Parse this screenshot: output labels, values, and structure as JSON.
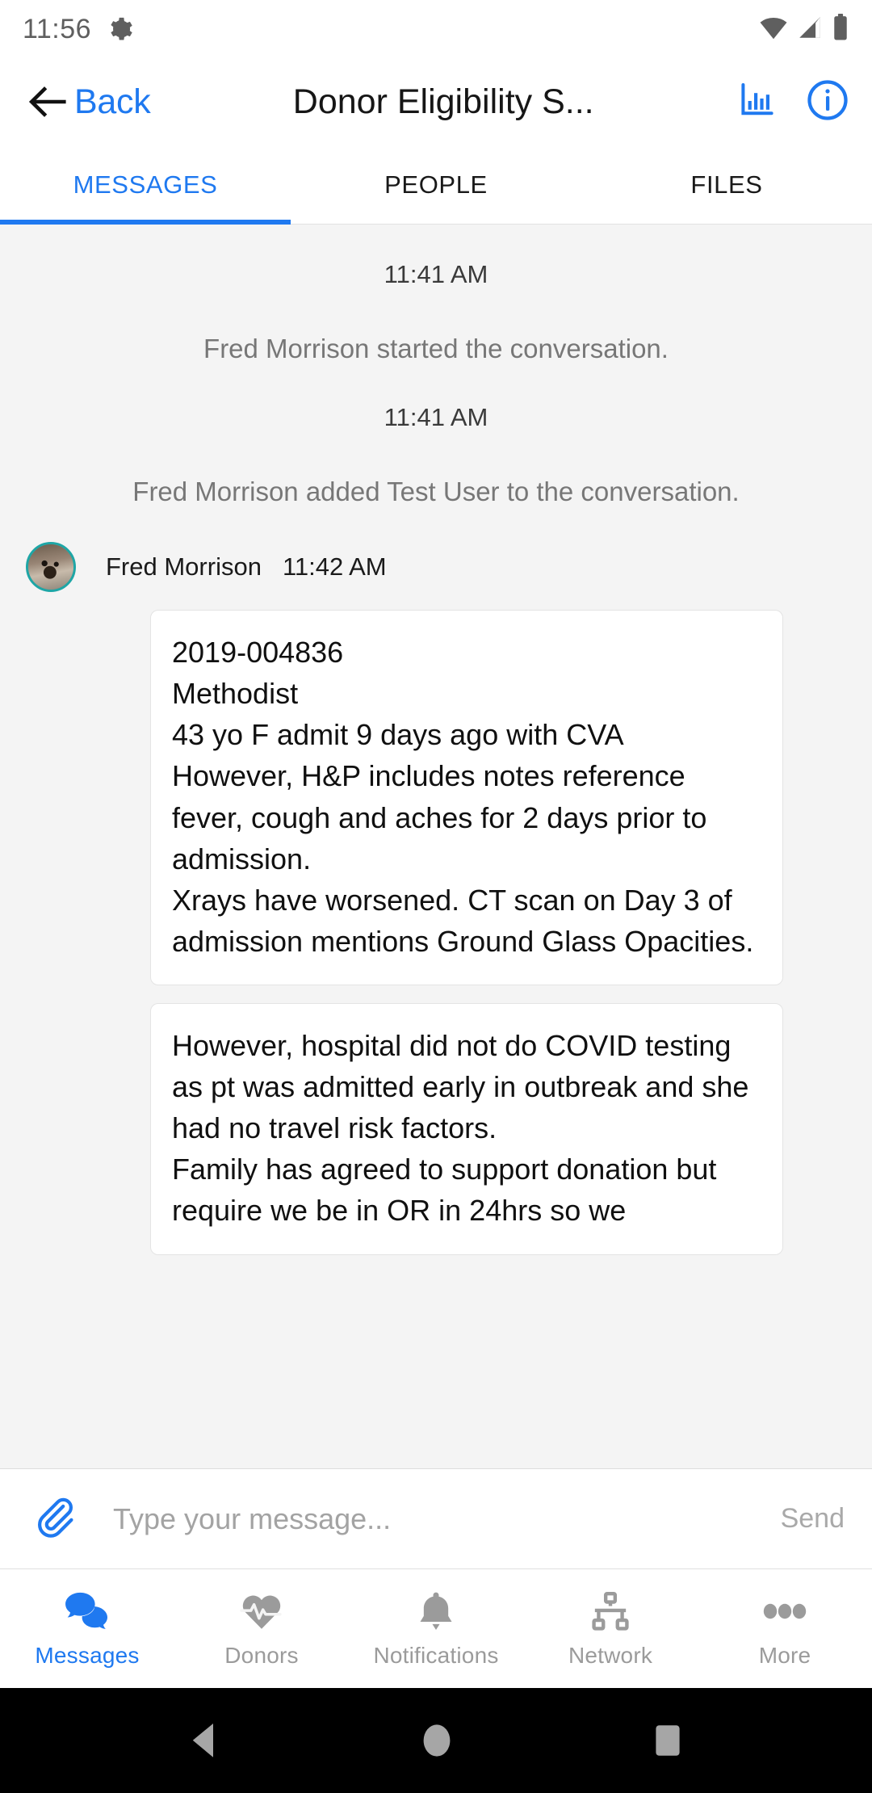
{
  "status_bar": {
    "time": "11:56",
    "icons": [
      "gear-icon",
      "wifi-icon",
      "cellular-signal-icon",
      "battery-icon"
    ]
  },
  "header": {
    "back_label": "Back",
    "title": "Donor Eligibility S...",
    "actions": [
      "bar-chart-icon",
      "info-circle-icon"
    ],
    "accent_color": "#1f79f0"
  },
  "tabs": [
    {
      "label": "MESSAGES",
      "active": true
    },
    {
      "label": "PEOPLE",
      "active": false
    },
    {
      "label": "FILES",
      "active": false
    }
  ],
  "conversation": {
    "events": [
      {
        "time": "11:41 AM",
        "text": "Fred Morrison started the conversation."
      },
      {
        "time": "11:41 AM",
        "text": "Fred Morrison added Test User to the conversation."
      }
    ],
    "message_group": {
      "sender": "Fred Morrison",
      "time": "11:42 AM",
      "avatar": "dog-photo-avatar",
      "bubbles": [
        "2019-004836\nMethodist\n43 yo F admit 9 days ago with CVA\nHowever, H&P includes notes reference fever, cough and aches for 2 days prior to admission.\nXrays have worsened. CT scan on Day 3 of admission mentions Ground Glass Opacities.",
        "However, hospital did not do COVID testing as pt was admitted early in outbreak and she had no travel risk factors.\nFamily has agreed to support donation but require we be in OR in 24hrs so we"
      ]
    }
  },
  "composer": {
    "attach_icon": "paperclip-icon",
    "placeholder": "Type your message...",
    "value": "",
    "send_label": "Send"
  },
  "bottom_nav": [
    {
      "label": "Messages",
      "icon": "chat-bubbles-icon",
      "active": true
    },
    {
      "label": "Donors",
      "icon": "heart-pulse-icon",
      "active": false
    },
    {
      "label": "Notifications",
      "icon": "bell-icon",
      "active": false
    },
    {
      "label": "Network",
      "icon": "org-chart-icon",
      "active": false
    },
    {
      "label": "More",
      "icon": "ellipsis-icon",
      "active": false
    }
  ],
  "system_nav": {
    "buttons": [
      "back-triangle-icon",
      "home-circle-icon",
      "recents-square-icon"
    ]
  }
}
